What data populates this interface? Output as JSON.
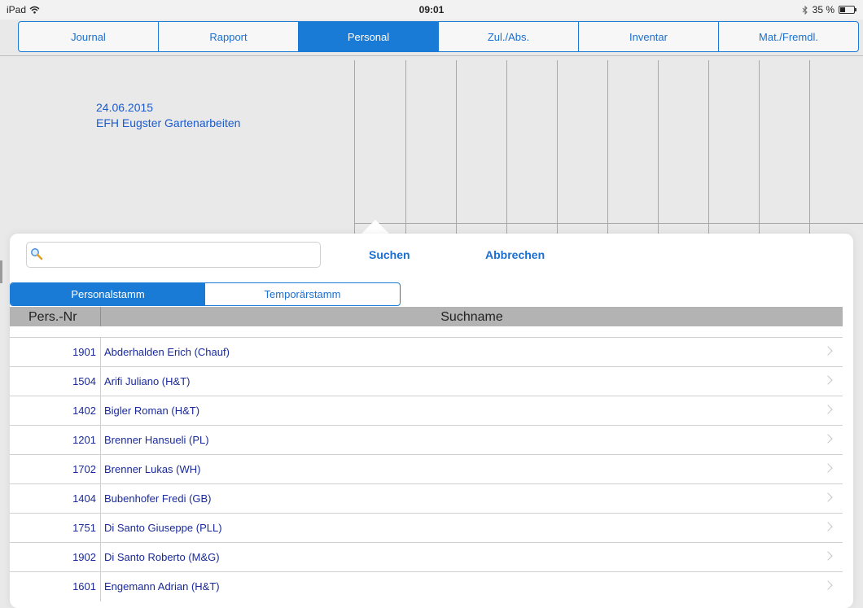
{
  "status": {
    "device": "iPad",
    "time": "09:01",
    "battery": "35 %",
    "battery_level": 0.35
  },
  "tabs": [
    {
      "label": "Journal",
      "active": false
    },
    {
      "label": "Rapport",
      "active": false
    },
    {
      "label": "Personal",
      "active": true
    },
    {
      "label": "Zul./Abs.",
      "active": false
    },
    {
      "label": "Inventar",
      "active": false
    },
    {
      "label": "Mat./Fremdl.",
      "active": false
    }
  ],
  "journal": {
    "date": "24.06.2015",
    "project": "EFH Eugster Gartenarbeiten"
  },
  "search": {
    "placeholder": "",
    "value": "",
    "search_label": "Suchen",
    "cancel_label": "Abbrechen"
  },
  "segments": [
    {
      "label": "Personalstamm",
      "active": true
    },
    {
      "label": "Temporärstamm",
      "active": false
    }
  ],
  "table": {
    "col_nr": "Pers.-Nr",
    "col_name": "Suchname",
    "rows": [
      {
        "nr": "1901",
        "name": "Abderhalden Erich (Chauf)"
      },
      {
        "nr": "1504",
        "name": "Arifi Juliano (H&T)"
      },
      {
        "nr": "1402",
        "name": "Bigler Roman (H&T)"
      },
      {
        "nr": "1201",
        "name": "Brenner Hansueli (PL)"
      },
      {
        "nr": "1702",
        "name": "Brenner Lukas (WH)"
      },
      {
        "nr": "1404",
        "name": "Bubenhofer Fredi (GB)"
      },
      {
        "nr": "1751",
        "name": "Di Santo Giuseppe (PLL)"
      },
      {
        "nr": "1902",
        "name": "Di Santo Roberto (M&G)"
      },
      {
        "nr": "1601",
        "name": "Engemann Adrian (H&T)"
      }
    ]
  },
  "colors": {
    "accent": "#1a7bd6",
    "row_text": "#1a2a9a",
    "header_bg": "#b3b3b3"
  }
}
